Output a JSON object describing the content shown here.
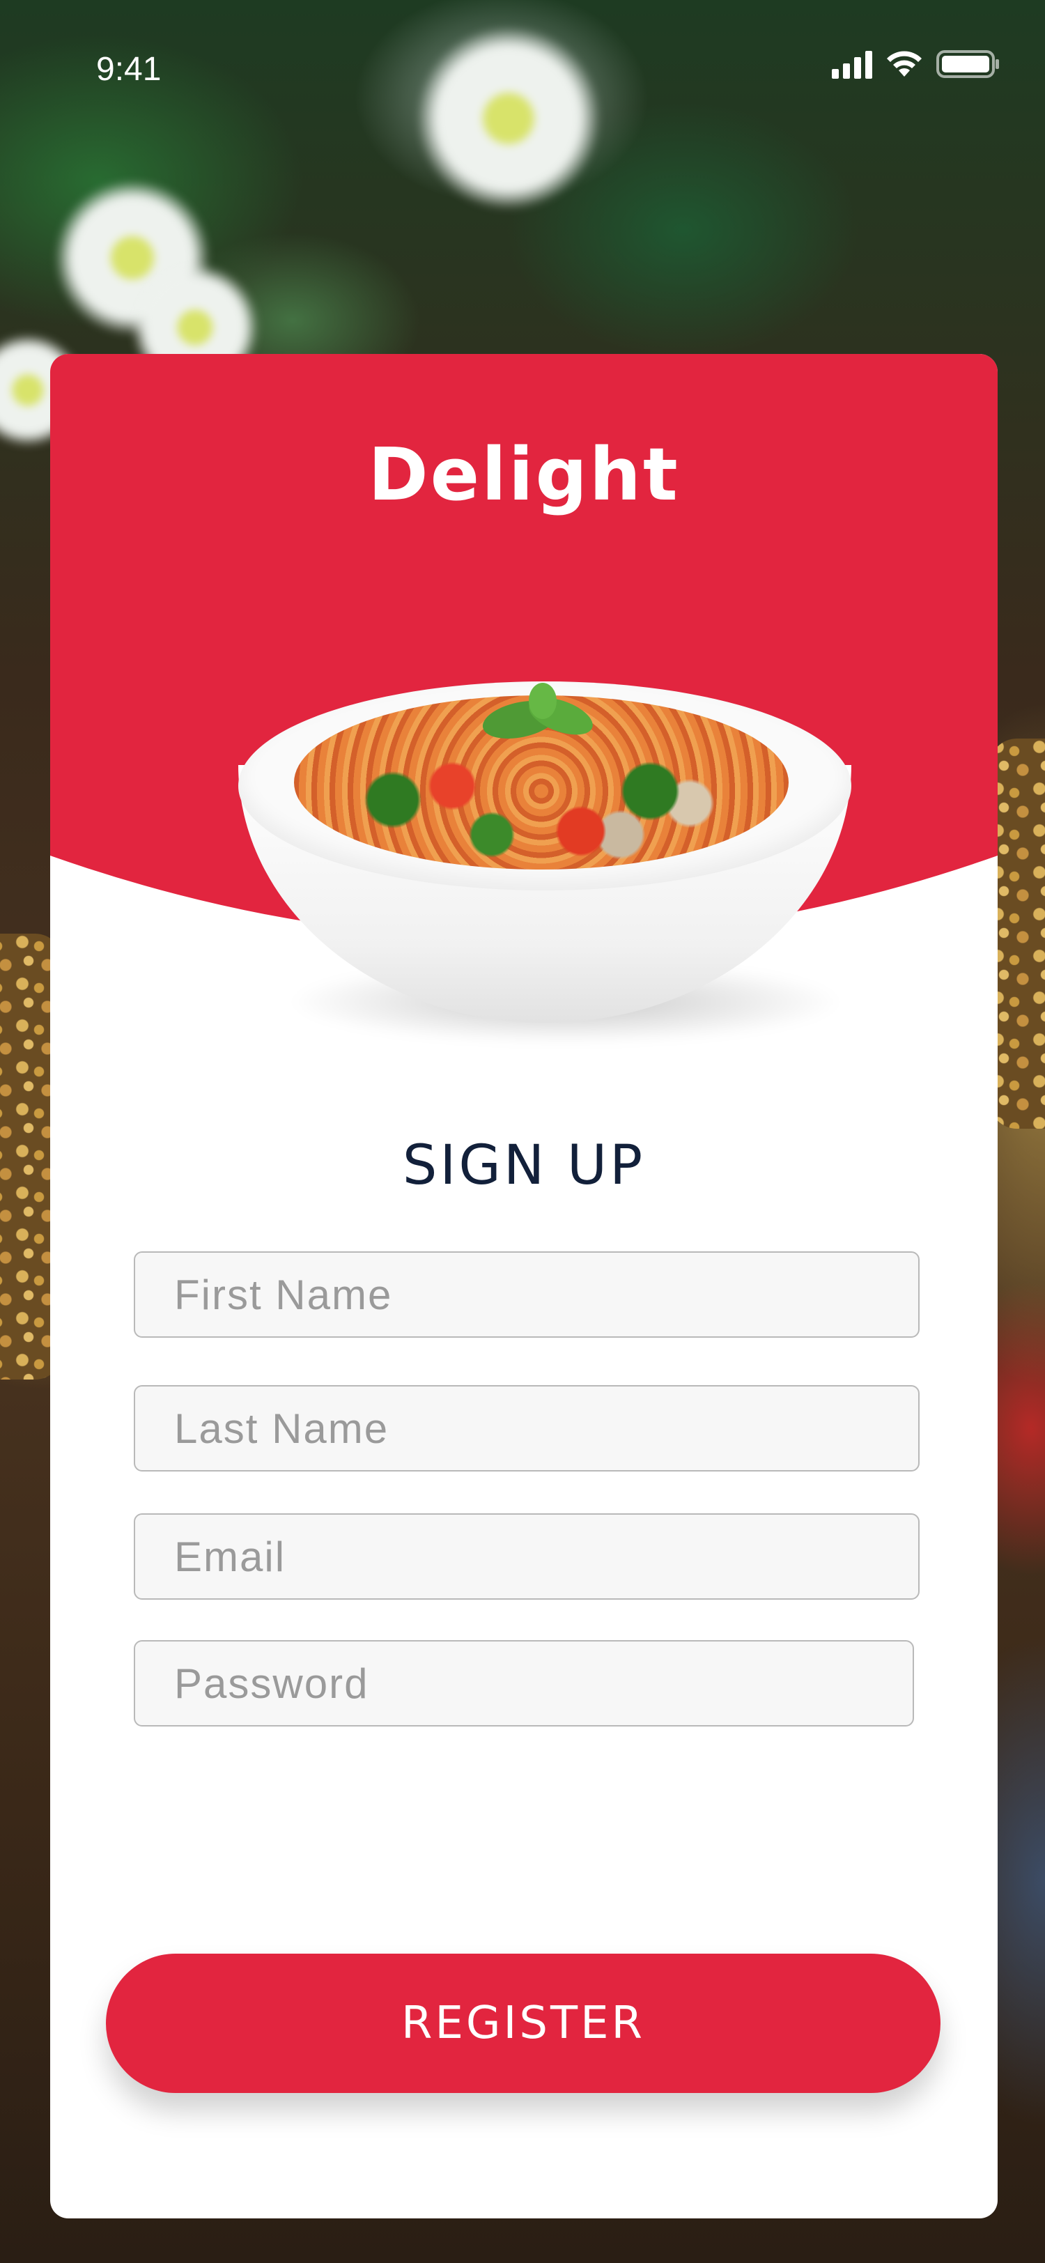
{
  "status_bar": {
    "time": "9:41",
    "icons": [
      "cellular-signal-icon",
      "wifi-icon",
      "battery-icon"
    ]
  },
  "app": {
    "brand_name": "Delight",
    "accent_color": "#e2253f",
    "title_color": "#12203a"
  },
  "form": {
    "title": "SIGN UP",
    "fields": [
      {
        "name": "first-name",
        "placeholder": "First Name",
        "value": ""
      },
      {
        "name": "last-name",
        "placeholder": "Last Name",
        "value": ""
      },
      {
        "name": "email",
        "placeholder": "Email",
        "value": ""
      },
      {
        "name": "password",
        "placeholder": "Password",
        "value": ""
      }
    ],
    "submit_label": "REGISTER"
  },
  "images": {
    "hero": "pasta-bowl-image",
    "background": "food-table-background-image"
  }
}
